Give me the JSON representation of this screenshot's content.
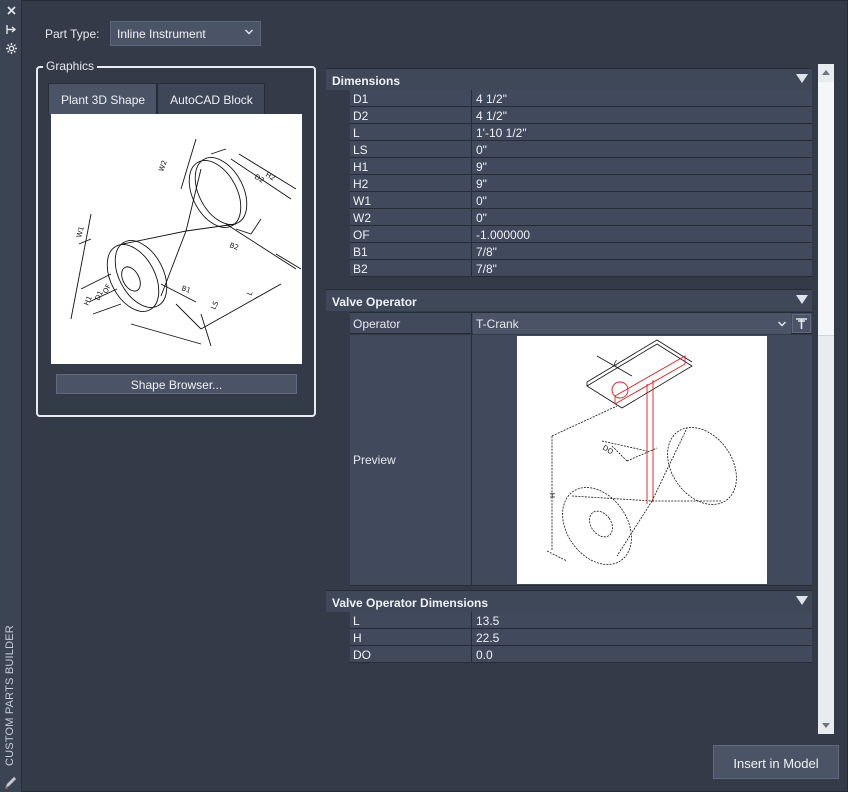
{
  "panel": {
    "vertical_title": "CUSTOM PARTS BUILDER",
    "icons": [
      "close-icon",
      "pin-icon",
      "settings-icon",
      "edit-pencil-icon"
    ]
  },
  "part_type": {
    "label": "Part Type:",
    "value": "Inline Instrument"
  },
  "graphics": {
    "legend": "Graphics",
    "tabs": [
      {
        "label": "Plant 3D Shape",
        "active": true
      },
      {
        "label": "AutoCAD Block",
        "active": false
      }
    ],
    "shape_browser_label": "Shape Browser..."
  },
  "dimensions": {
    "title": "Dimensions",
    "rows": [
      {
        "key": "D1",
        "value": "4 1/2\""
      },
      {
        "key": "D2",
        "value": "4 1/2\""
      },
      {
        "key": "L",
        "value": "1'-10 1/2\""
      },
      {
        "key": "LS",
        "value": "0\""
      },
      {
        "key": "H1",
        "value": "9\""
      },
      {
        "key": "H2",
        "value": "9\""
      },
      {
        "key": "W1",
        "value": "0\""
      },
      {
        "key": "W2",
        "value": "0\""
      },
      {
        "key": "OF",
        "value": "-1.000000"
      },
      {
        "key": "B1",
        "value": "7/8\""
      },
      {
        "key": "B2",
        "value": "7/8\""
      }
    ]
  },
  "valve_operator": {
    "title": "Valve Operator",
    "operator_label": "Operator",
    "operator_value": "T-Crank",
    "preview_label": "Preview"
  },
  "valve_operator_dimensions": {
    "title": "Valve Operator Dimensions",
    "rows": [
      {
        "key": "L",
        "value": "13.5"
      },
      {
        "key": "H",
        "value": "22.5"
      },
      {
        "key": "DO",
        "value": "0.0"
      }
    ]
  },
  "drawing_labels": {
    "shape": [
      "H2",
      "D2",
      "W2",
      "B2",
      "W1",
      "H1",
      "D1",
      "OF",
      "B1",
      "LS",
      "L"
    ],
    "operator": [
      "L",
      "DO",
      "H"
    ]
  },
  "actions": {
    "insert_label": "Insert in Model"
  }
}
